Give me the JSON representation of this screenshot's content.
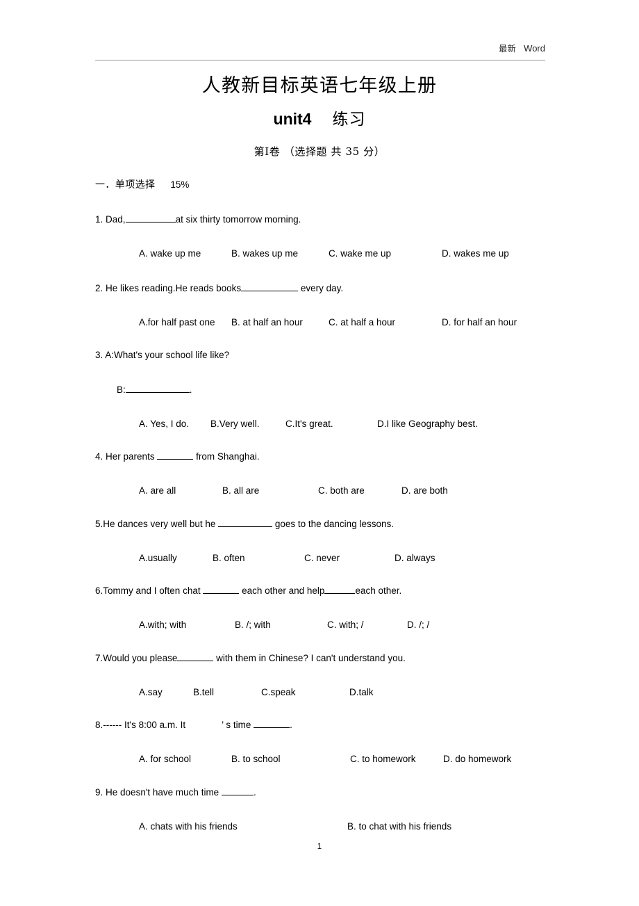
{
  "header": {
    "cjk": "最新",
    "word": "Word"
  },
  "title": "人教新目标英语七年级上册",
  "subtitle": {
    "unit": "unit4",
    "cn": "练习"
  },
  "part_line": "第Ⅰ卷 （选择题  共 35 分）",
  "section": {
    "label": "一．单项选择",
    "percent": "15%"
  },
  "footer": {
    "page_number": "1"
  },
  "questions": [
    {
      "number": "1.",
      "stem_before": "Dad,",
      "stem_after": "at six thirty tomorrow morning.",
      "options": [
        "A. wake up me",
        "B. wakes up me",
        "C. wake me up",
        "D. wakes me up"
      ]
    },
    {
      "number": "2.",
      "stem_before": "He likes reading.He reads books",
      "stem_after": " every day.",
      "options": [
        "A.for half past one",
        "B. at half an hour",
        "C. at half a hour",
        "D. for half an hour"
      ]
    },
    {
      "number": "3.",
      "stem_before": "A:What's your school life like?",
      "stem_after": "",
      "sub_label": "B:",
      "sub_after": ".",
      "options": [
        "A. Yes, I do.",
        "B.Very well.",
        "C.It's great.",
        "D.I like Geography best."
      ]
    },
    {
      "number": "4.",
      "stem_before": "Her parents ",
      "stem_after": " from Shanghai.",
      "options": [
        "A. are all",
        "B. all are",
        "C. both are",
        "D. are both"
      ]
    },
    {
      "number": "5.",
      "stem_before": "He dances very well but he ",
      "stem_after": " goes to the dancing lessons.",
      "options": [
        "A.usually",
        "B. often",
        "C. never",
        "D. always"
      ]
    },
    {
      "number": "6.",
      "stem_before": "Tommy and I often chat ",
      "stem_mid": " each other and help",
      "stem_after": "each other.",
      "options": [
        "A.with; with",
        "B. /; with",
        "C. with; /",
        "D. /; /"
      ]
    },
    {
      "number": "7.",
      "stem_before": "Would you please",
      "stem_after": " with them in Chinese? I can't understand you.",
      "options": [
        "A.say",
        "B.tell",
        "C.speak",
        "D.talk"
      ]
    },
    {
      "number": "8.",
      "stem_before": "------ It's 8:00 a.m. It",
      "stem_mid": "’ s time ",
      "stem_after": ".",
      "options": [
        "A. for school",
        "B. to school",
        "C. to homework",
        "D. do homework"
      ]
    },
    {
      "number": "9.",
      "stem_before": "He doesn't have much time ",
      "stem_after": ".",
      "options": [
        "A. chats with his friends",
        "B. to chat with his friends"
      ]
    }
  ]
}
